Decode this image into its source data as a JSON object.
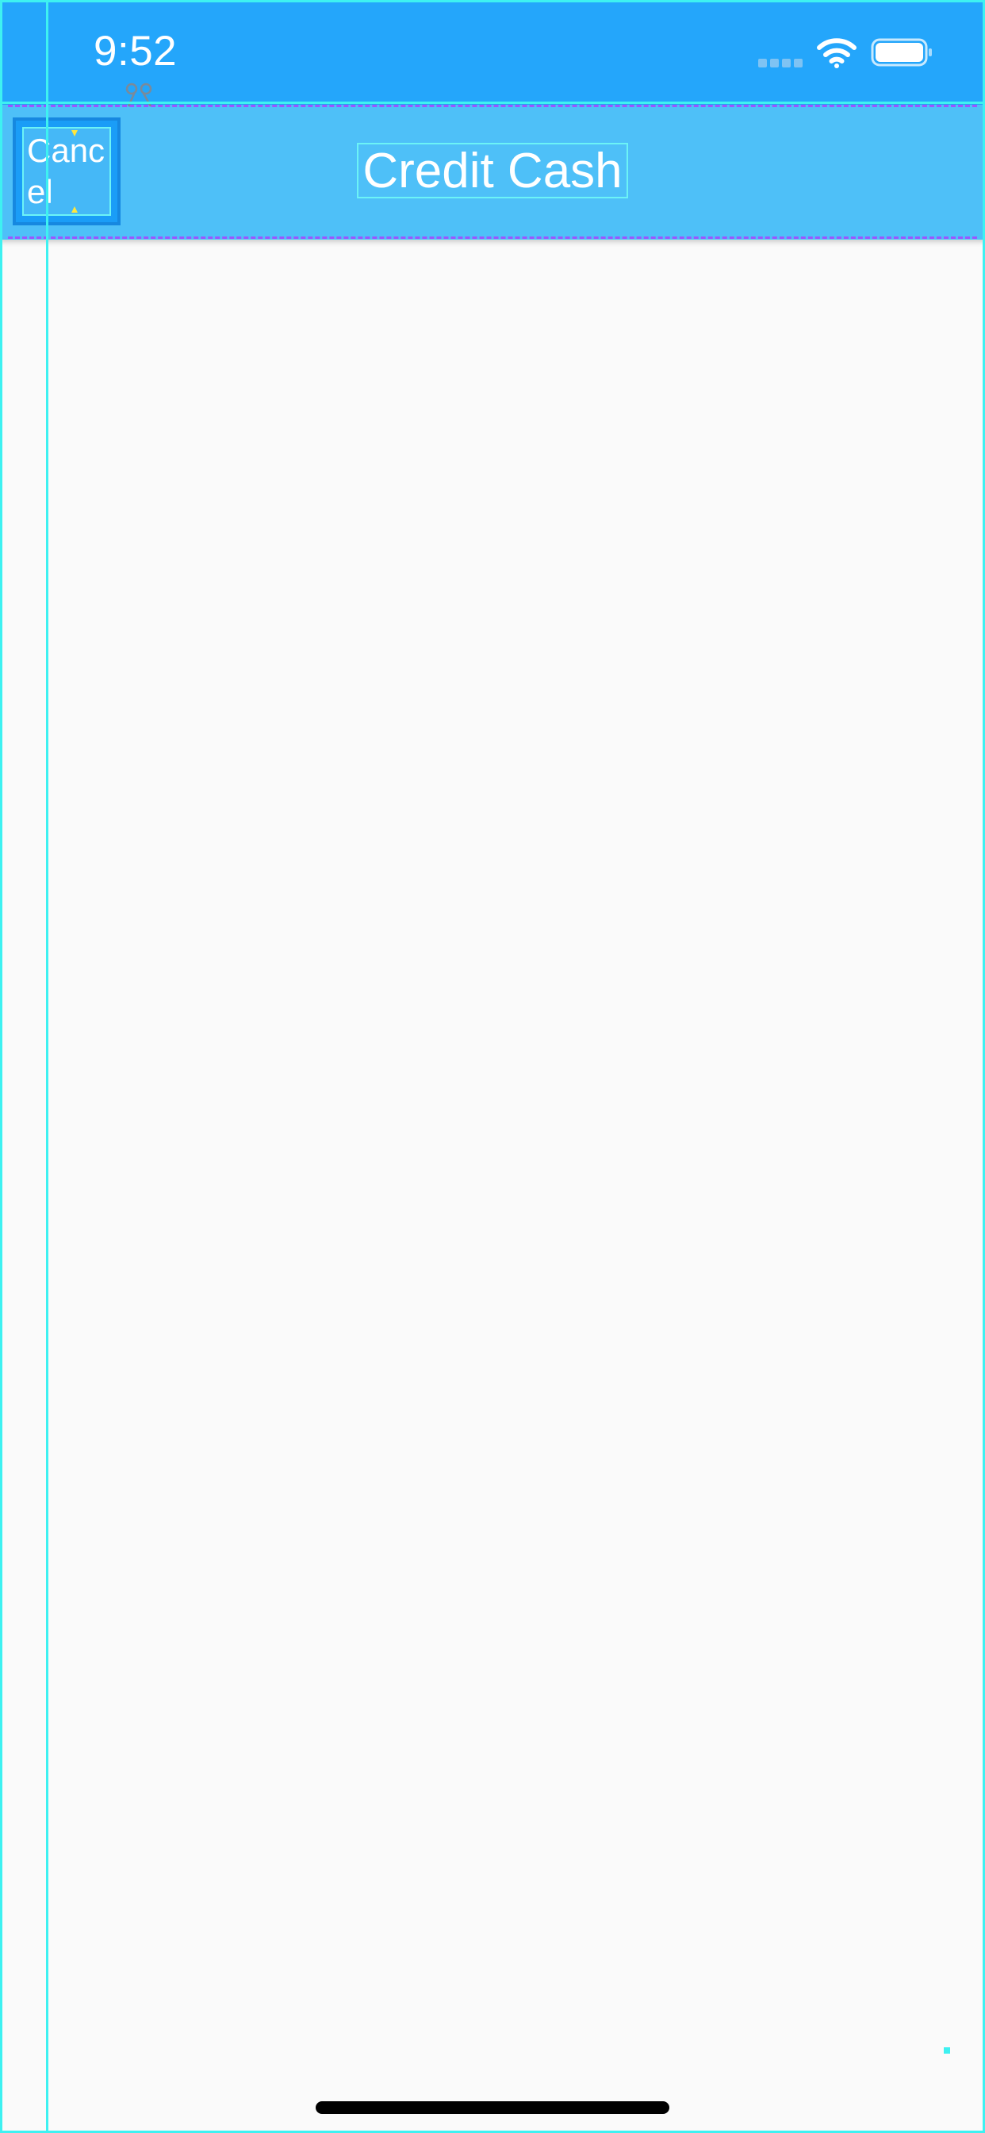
{
  "status_bar": {
    "time": "9:52",
    "icons": [
      "signal-dots-icon",
      "wifi-icon",
      "battery-icon"
    ]
  },
  "nav_bar": {
    "cancel_label": "Cancel",
    "title": "Credit Cash"
  },
  "colors": {
    "status_bar_bg": "#24a6fb",
    "nav_bar_bg": "#4ec0f8",
    "content_bg": "#fafafa",
    "guide_cyan": "#3ef1f1",
    "guide_dash_purple": "#9b55ff",
    "text_white": "#ffffff"
  }
}
